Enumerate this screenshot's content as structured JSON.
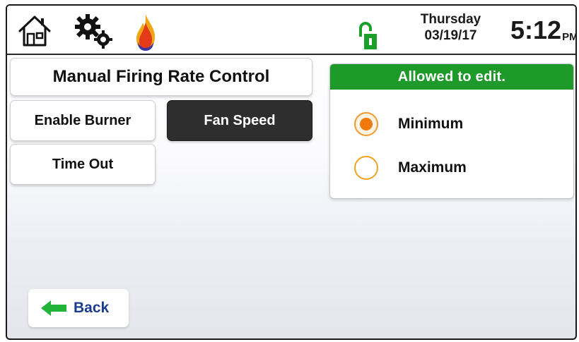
{
  "statusbar": {
    "icons": {
      "home": "home-icon",
      "settings": "gear-icon",
      "burner": "flame-icon",
      "lock": "unlocked-padlock-icon"
    },
    "day": "Thursday",
    "date": "03/19/17",
    "time": "5:12",
    "ampm": "PM"
  },
  "main": {
    "title": "Manual Firing Rate Control",
    "enable_burner_label": "Enable Burner",
    "fan_speed_label": "Fan Speed",
    "time_out_label": "Time Out"
  },
  "edit_panel": {
    "header": "Allowed to edit.",
    "options": [
      {
        "label": "Minimum",
        "selected": true
      },
      {
        "label": "Maximum",
        "selected": false
      }
    ]
  },
  "footer": {
    "back_label": "Back",
    "back_icon": "back-arrow-icon"
  },
  "colors": {
    "header_green": "#1e9a2a",
    "radio_orange": "#f07a10",
    "fan_button_dark": "#2e2e2e",
    "lock_green": "#1aa02a",
    "back_text_blue": "#1b3d8f"
  }
}
